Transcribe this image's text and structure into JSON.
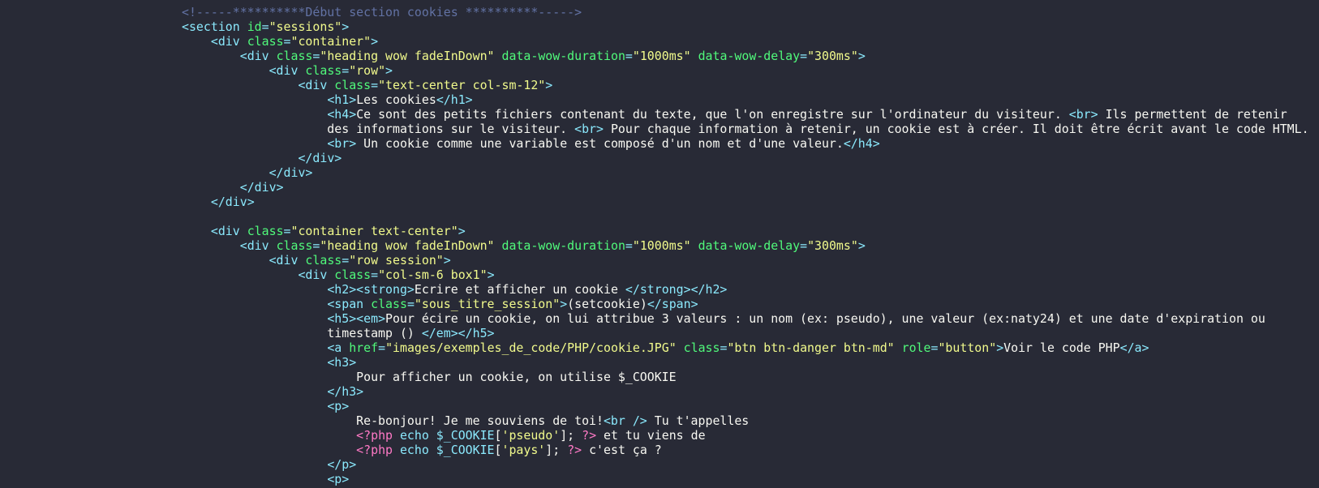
{
  "theme": {
    "background": "#282a36",
    "comment": "#6272a4",
    "tag": "#8be9fd",
    "attribute": "#50fa7b",
    "string": "#f1fa8c",
    "text": "#f8f8f2",
    "php": "#ff79c6"
  },
  "lines": [
    [
      [
        "cm",
        "<!-----**********Début section cookies **********----->"
      ]
    ],
    [
      [
        "tg",
        "<section "
      ],
      [
        "at",
        "id"
      ],
      [
        "tg",
        "="
      ],
      [
        "st",
        "\"sessions\""
      ],
      [
        "tg",
        ">"
      ]
    ],
    [
      [
        "tx",
        "    "
      ],
      [
        "tg",
        "<div "
      ],
      [
        "at",
        "class"
      ],
      [
        "tg",
        "="
      ],
      [
        "st",
        "\"container\""
      ],
      [
        "tg",
        ">"
      ]
    ],
    [
      [
        "tx",
        "        "
      ],
      [
        "tg",
        "<div "
      ],
      [
        "at",
        "class"
      ],
      [
        "tg",
        "="
      ],
      [
        "st",
        "\"heading wow fadeInDown\""
      ],
      [
        "tx",
        " "
      ],
      [
        "at",
        "data-wow-duration"
      ],
      [
        "tg",
        "="
      ],
      [
        "st",
        "\"1000ms\""
      ],
      [
        "tx",
        " "
      ],
      [
        "at",
        "data-wow-delay"
      ],
      [
        "tg",
        "="
      ],
      [
        "st",
        "\"300ms\""
      ],
      [
        "tg",
        ">"
      ]
    ],
    [
      [
        "tx",
        "            "
      ],
      [
        "tg",
        "<div "
      ],
      [
        "at",
        "class"
      ],
      [
        "tg",
        "="
      ],
      [
        "st",
        "\"row\""
      ],
      [
        "tg",
        ">"
      ]
    ],
    [
      [
        "tx",
        "                "
      ],
      [
        "tg",
        "<div "
      ],
      [
        "at",
        "class"
      ],
      [
        "tg",
        "="
      ],
      [
        "st",
        "\"text-center col-sm-12\""
      ],
      [
        "tg",
        ">"
      ]
    ],
    [
      [
        "tx",
        "                    "
      ],
      [
        "tg",
        "<h1>"
      ],
      [
        "tx",
        "Les cookies"
      ],
      [
        "tg",
        "</h1>"
      ]
    ],
    [
      [
        "tx",
        "                    "
      ],
      [
        "tg",
        "<h4>"
      ],
      [
        "tx",
        "Ce sont des petits fichiers contenant du texte, que l'on enregistre sur l'ordinateur du visiteur. "
      ],
      [
        "tg",
        "<br>"
      ],
      [
        "tx",
        " Ils permettent de retenir"
      ]
    ],
    [
      [
        "tx",
        "                    des informations sur le visiteur. "
      ],
      [
        "tg",
        "<br>"
      ],
      [
        "tx",
        " Pour chaque information à retenir, un cookie est à créer. Il doit être écrit avant le code HTML."
      ]
    ],
    [
      [
        "tx",
        "                    "
      ],
      [
        "tg",
        "<br>"
      ],
      [
        "tx",
        " Un cookie comme une variable est composé d'un nom et d'une valeur."
      ],
      [
        "tg",
        "</h4>"
      ]
    ],
    [
      [
        "tx",
        "                "
      ],
      [
        "tg",
        "</div>"
      ]
    ],
    [
      [
        "tx",
        "            "
      ],
      [
        "tg",
        "</div>"
      ]
    ],
    [
      [
        "tx",
        "        "
      ],
      [
        "tg",
        "</div>"
      ]
    ],
    [
      [
        "tx",
        "    "
      ],
      [
        "tg",
        "</div>"
      ]
    ],
    [],
    [
      [
        "tx",
        "    "
      ],
      [
        "tg",
        "<div "
      ],
      [
        "at",
        "class"
      ],
      [
        "tg",
        "="
      ],
      [
        "st",
        "\"container text-center\""
      ],
      [
        "tg",
        ">"
      ]
    ],
    [
      [
        "tx",
        "        "
      ],
      [
        "tg",
        "<div "
      ],
      [
        "at",
        "class"
      ],
      [
        "tg",
        "="
      ],
      [
        "st",
        "\"heading wow fadeInDown\""
      ],
      [
        "tx",
        " "
      ],
      [
        "at",
        "data-wow-duration"
      ],
      [
        "tg",
        "="
      ],
      [
        "st",
        "\"1000ms\""
      ],
      [
        "tx",
        " "
      ],
      [
        "at",
        "data-wow-delay"
      ],
      [
        "tg",
        "="
      ],
      [
        "st",
        "\"300ms\""
      ],
      [
        "tg",
        ">"
      ]
    ],
    [
      [
        "tx",
        "            "
      ],
      [
        "tg",
        "<div "
      ],
      [
        "at",
        "class"
      ],
      [
        "tg",
        "="
      ],
      [
        "st",
        "\"row session\""
      ],
      [
        "tg",
        ">"
      ]
    ],
    [
      [
        "tx",
        "                "
      ],
      [
        "tg",
        "<div "
      ],
      [
        "at",
        "class"
      ],
      [
        "tg",
        "="
      ],
      [
        "st",
        "\"col-sm-6 box1\""
      ],
      [
        "tg",
        ">"
      ]
    ],
    [
      [
        "tx",
        "                    "
      ],
      [
        "tg",
        "<h2><strong>"
      ],
      [
        "tx",
        "Ecrire et afficher un cookie "
      ],
      [
        "tg",
        "</strong></h2>"
      ]
    ],
    [
      [
        "tx",
        "                    "
      ],
      [
        "tg",
        "<span "
      ],
      [
        "at",
        "class"
      ],
      [
        "tg",
        "="
      ],
      [
        "st",
        "\"sous_titre_session\""
      ],
      [
        "tg",
        ">"
      ],
      [
        "tx",
        "(setcookie)"
      ],
      [
        "tg",
        "</span>"
      ]
    ],
    [
      [
        "tx",
        "                    "
      ],
      [
        "tg",
        "<h5><em>"
      ],
      [
        "tx",
        "Pour écire un cookie, on lui attribue 3 valeurs : un nom (ex: pseudo), une valeur (ex:naty24) et une date d'expiration ou"
      ]
    ],
    [
      [
        "tx",
        "                    timestamp () "
      ],
      [
        "tg",
        "</em></h5>"
      ]
    ],
    [
      [
        "tx",
        "                    "
      ],
      [
        "tg",
        "<a "
      ],
      [
        "at",
        "href"
      ],
      [
        "tg",
        "="
      ],
      [
        "st",
        "\"images/exemples_de_code/PHP/cookie.JPG\""
      ],
      [
        "tx",
        " "
      ],
      [
        "at",
        "class"
      ],
      [
        "tg",
        "="
      ],
      [
        "st",
        "\"btn btn-danger btn-md\""
      ],
      [
        "tx",
        " "
      ],
      [
        "at",
        "role"
      ],
      [
        "tg",
        "="
      ],
      [
        "st",
        "\"button\""
      ],
      [
        "tg",
        ">"
      ],
      [
        "tx",
        "Voir le code PHP"
      ],
      [
        "tg",
        "</a>"
      ]
    ],
    [
      [
        "tx",
        "                    "
      ],
      [
        "tg",
        "<h3>"
      ]
    ],
    [
      [
        "tx",
        "                        Pour afficher un cookie, on utilise $_COOKIE"
      ]
    ],
    [
      [
        "tx",
        "                    "
      ],
      [
        "tg",
        "</h3>"
      ]
    ],
    [
      [
        "tx",
        "                    "
      ],
      [
        "tg",
        "<p>"
      ]
    ],
    [
      [
        "tx",
        "                        Re-bonjour! Je me souviens de toi!"
      ],
      [
        "tg",
        "<br />"
      ],
      [
        "tx",
        " Tu t'appelles"
      ]
    ],
    [
      [
        "tx",
        "                        "
      ],
      [
        "ph",
        "<?php"
      ],
      [
        "tx",
        " "
      ],
      [
        "fn",
        "echo $_COOKIE"
      ],
      [
        "tx",
        "["
      ],
      [
        "st",
        "'pseudo'"
      ],
      [
        "tx",
        "]; "
      ],
      [
        "ph",
        "?>"
      ],
      [
        "tx",
        " et tu viens de"
      ]
    ],
    [
      [
        "tx",
        "                        "
      ],
      [
        "ph",
        "<?php"
      ],
      [
        "tx",
        " "
      ],
      [
        "fn",
        "echo $_COOKIE"
      ],
      [
        "tx",
        "["
      ],
      [
        "st",
        "'pays'"
      ],
      [
        "tx",
        "]; "
      ],
      [
        "ph",
        "?>"
      ],
      [
        "tx",
        " c'est ça ?"
      ]
    ],
    [
      [
        "tx",
        "                    "
      ],
      [
        "tg",
        "</p>"
      ]
    ],
    [
      [
        "tx",
        "                    "
      ],
      [
        "tg",
        "<p>"
      ]
    ]
  ]
}
